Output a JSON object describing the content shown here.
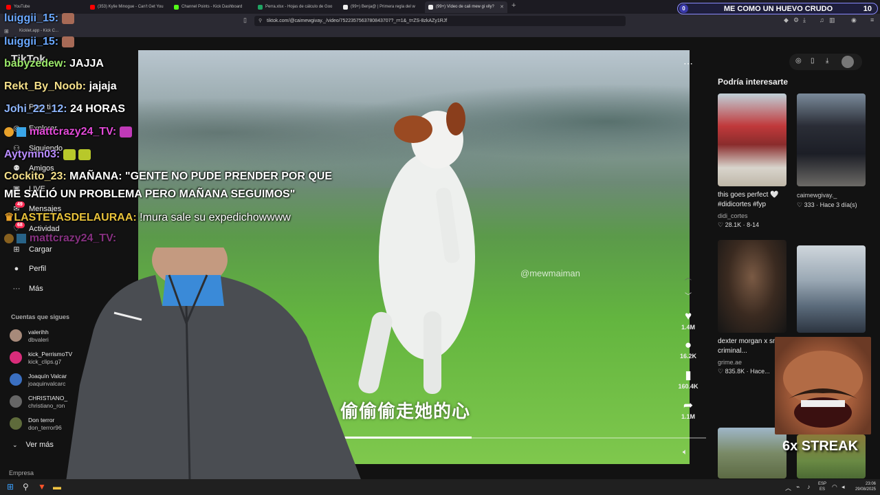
{
  "browser": {
    "tabs": [
      {
        "label": "YouTube",
        "active": false
      },
      {
        "label": "(353) Kylie Minogue - Can't Get You",
        "active": false
      },
      {
        "label": "Channel Points - Kick Dashboard",
        "active": false
      },
      {
        "label": "Perra.xlsx - Hojas de cálculo de Goo",
        "active": false
      },
      {
        "label": "(99+) Benja@ | Primera regla del w",
        "active": false
      },
      {
        "label": "(99+) Vídeo de cali mew gi vily?",
        "active": true
      }
    ],
    "new_tab": "+",
    "url": "tiktok.com/@caimewgivay._/video/7522357563780843707?_r=1&_t=ZS-8zkAZy1RJf",
    "bookmark": "Kicklet.app - Kick C..."
  },
  "stream_overlay": {
    "title": "ME COMO UN HUEVO CRUDO",
    "left_value": "0",
    "right_value": "10"
  },
  "tiktok": {
    "logo": "TikTok",
    "nav": [
      {
        "label": "Para ti",
        "icon": "home-icon"
      },
      {
        "label": "Explorar",
        "icon": "compass-icon"
      },
      {
        "label": "Siguiendo",
        "icon": "following-icon"
      },
      {
        "label": "Amigos",
        "icon": "friends-icon"
      },
      {
        "label": "LIVE",
        "icon": "live-icon"
      },
      {
        "label": "Mensajes",
        "icon": "messages-icon",
        "badge": "49"
      },
      {
        "label": "Actividad",
        "icon": "activity-icon",
        "badge": "68"
      },
      {
        "label": "Cargar",
        "icon": "upload-icon"
      },
      {
        "label": "Perfil",
        "icon": "profile-icon"
      },
      {
        "label": "Más",
        "icon": "more-icon"
      }
    ],
    "following_title": "Cuentas que sigues",
    "following": [
      {
        "name": "valerihh",
        "handle": "dbvaleri"
      },
      {
        "name": "kick_PerrismoTV",
        "handle": "kick_clips.g7"
      },
      {
        "name": "Joaquín Valcar",
        "handle": "joaquinvalcarc"
      },
      {
        "name": "CHRISTIANO_",
        "handle": "christiano_ron"
      },
      {
        "name": "Don terror",
        "handle": "don_terror96"
      }
    ],
    "see_more": "Ver más",
    "footer_label": "Empresa",
    "video": {
      "watermark": "@mewmaiman",
      "subtitle": "偷偷偷走她的心",
      "progress": 0.46,
      "actions": [
        {
          "icon": "heart-icon",
          "count": "1.4M"
        },
        {
          "icon": "comment-icon",
          "count": "16.2K"
        },
        {
          "icon": "bookmark-icon",
          "count": "160.4K"
        },
        {
          "icon": "share-icon",
          "count": "1.1M"
        }
      ]
    },
    "suggested_title": "Podría interesarte",
    "suggested": [
      {
        "caption": "this goes perfect 🤍 #didicortes #fyp",
        "author": "didi_cortes",
        "likes": "28.1K",
        "date": "8-14"
      },
      {
        "caption": "",
        "author": "caimewgivay._",
        "likes": "333",
        "date": "Hace 3 día(s)"
      },
      {
        "caption": "dexter morgan x smooth criminal...",
        "author": "grime.ae",
        "likes": "835.8K",
        "date": "Hace..."
      },
      {
        "caption": "",
        "author": "",
        "likes": "",
        "date": ""
      }
    ]
  },
  "chat": [
    {
      "user": "luiggii_15:",
      "message": "",
      "color": "#6aa8ff"
    },
    {
      "user": "luiggii_15:",
      "message": "",
      "color": "#6aa8ff"
    },
    {
      "user": "babyzedew:",
      "message": "JAJJA",
      "color": "#9be86a"
    },
    {
      "user": "Rekt_By_Noob:",
      "message": "jajaja",
      "color": "#f5e08a"
    },
    {
      "user": "Johi_22_12:",
      "message": "24 HORAS",
      "color": "#8fb7ff"
    },
    {
      "user": "mattcrazy24_TV:",
      "message": "",
      "color": "#e34ad8"
    },
    {
      "user": "Aytymn03:",
      "message": "",
      "color": "#b98cff"
    },
    {
      "user": "Cockito_23:",
      "message": "MAÑANA: \"GENTE NO PUDE PRENDER POR QUE",
      "color": "#f5e08a"
    },
    {
      "user": "",
      "message": "ME SALIÓ UN PROBLEMA PERO MAÑANA SEGUIMOS\"",
      "color": "#ffffff"
    },
    {
      "user": "LASTETASDELAURAA:",
      "message": "!mura sale su expedichowwww",
      "color": "#e8c23a"
    },
    {
      "user": "mattcrazy24_TV:",
      "message": "",
      "color": "#e34ad8"
    }
  ],
  "reaction_overlay": {
    "streak": "6x STREAK"
  },
  "taskbar": {
    "lang1": "ESP",
    "lang2": "ES",
    "time": "23:06",
    "date": "29/08/2025"
  }
}
